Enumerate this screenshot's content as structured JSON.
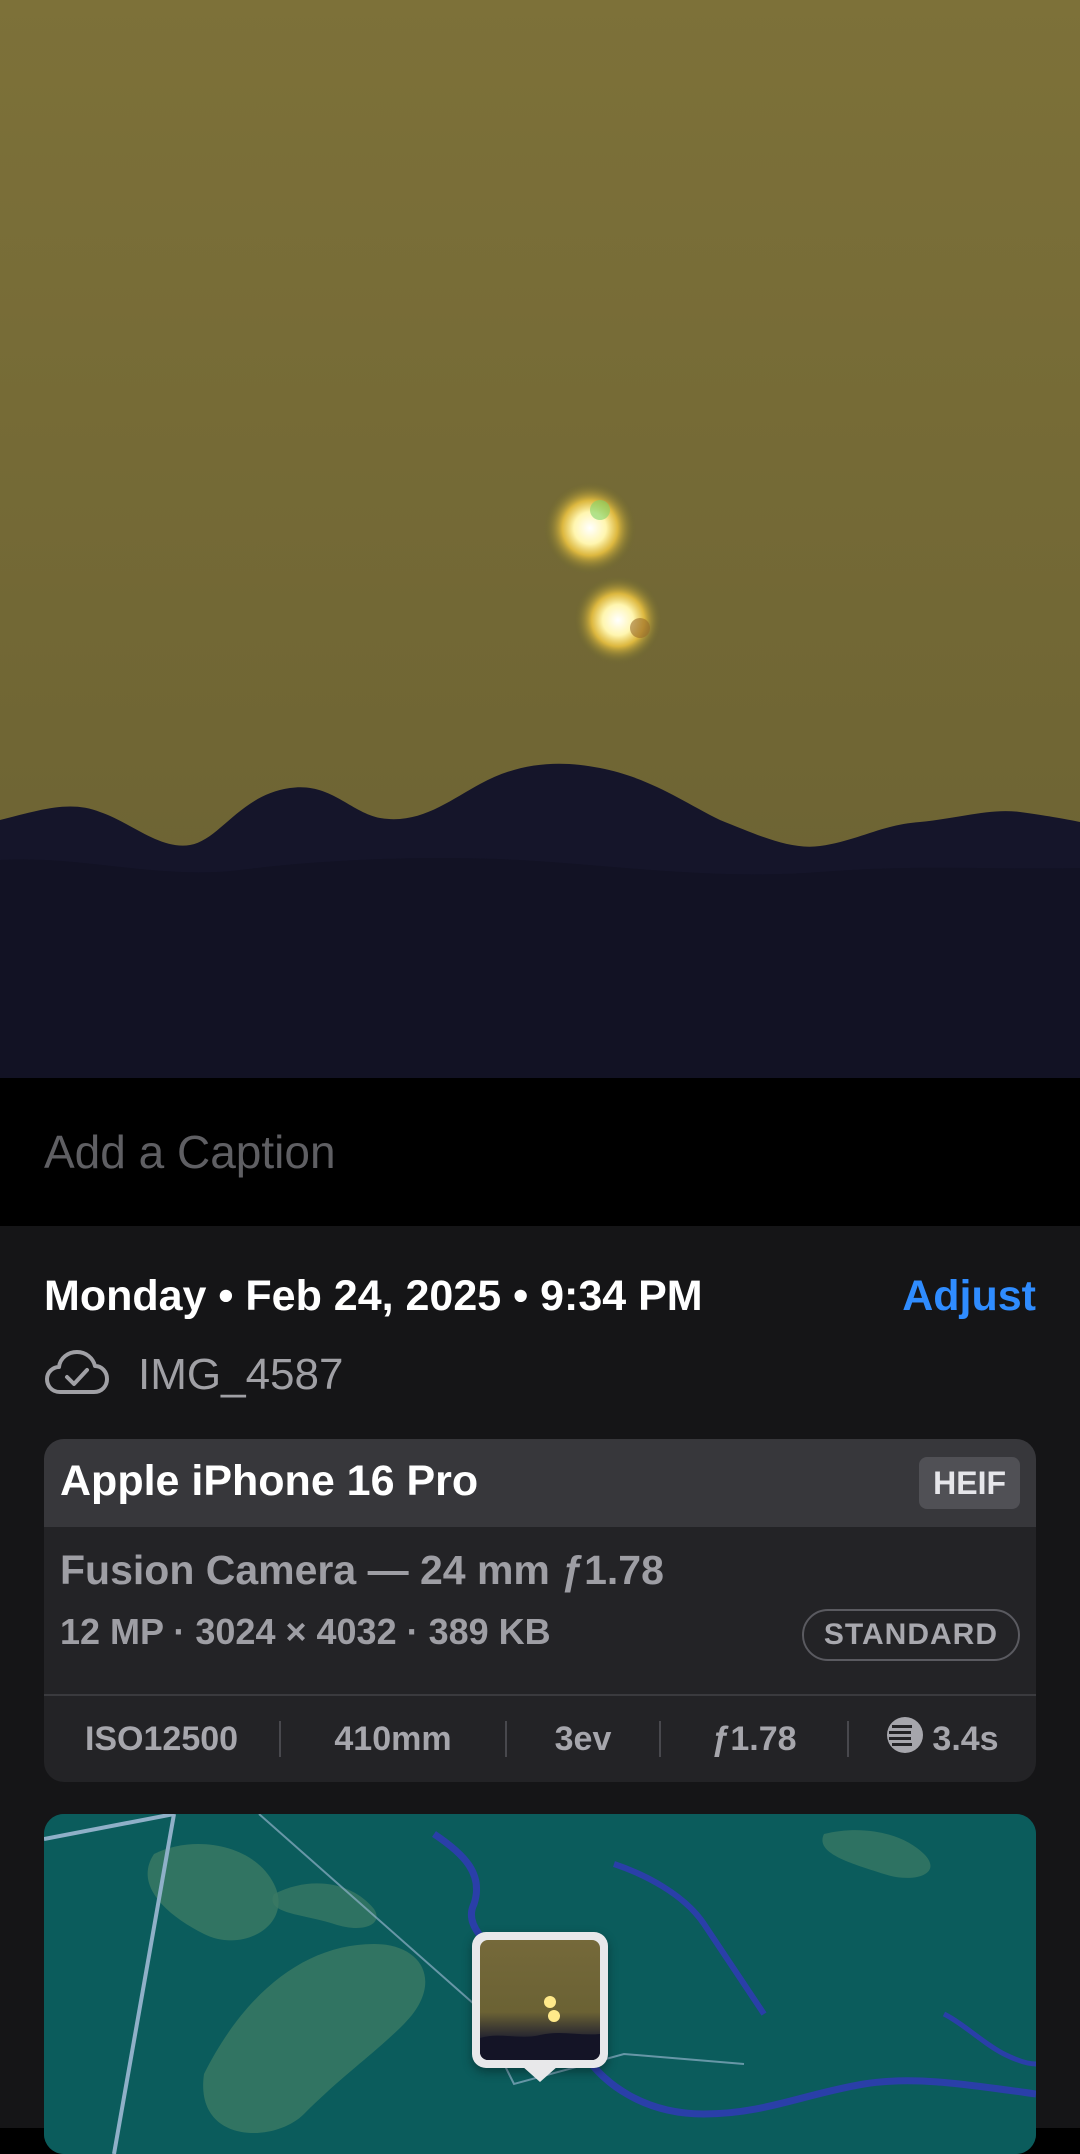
{
  "caption": {
    "placeholder": "Add a Caption",
    "value": ""
  },
  "info": {
    "date_line": "Monday • Feb 24, 2025 • 9:34 PM",
    "adjust_label": "Adjust",
    "file_name": "IMG_4587",
    "icon": "icloud-check-icon"
  },
  "camera": {
    "device": "Apple iPhone 16 Pro",
    "format_badge": "HEIF",
    "lens": "Fusion Camera — 24 mm ƒ1.78",
    "specs": "12 MP · 3024 × 4032 · 389 KB",
    "style_badge": "STANDARD",
    "exif": {
      "iso": "ISO12500",
      "focal_length": "410mm",
      "exposure_bias": "3ev",
      "aperture": "ƒ1.78",
      "shutter": "3.4s",
      "shutter_icon": "shutter-speed-icon"
    }
  },
  "colors": {
    "accent": "#2f8cff",
    "panel_bg": "#151517",
    "card_bg": "#232326",
    "map_water": "#0b5c5c"
  },
  "map": {
    "icon": "photo-location-pin"
  }
}
